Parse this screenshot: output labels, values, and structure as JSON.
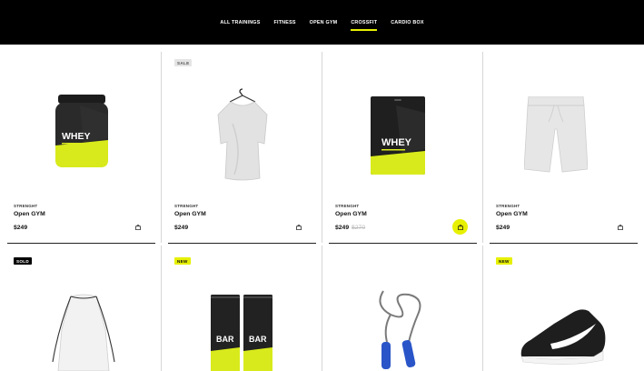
{
  "nav": {
    "tabs": [
      {
        "label": "ALL TRAININGS",
        "active": false
      },
      {
        "label": "FITNESS",
        "active": false
      },
      {
        "label": "OPEN GYM",
        "active": false
      },
      {
        "label": "CROSSFIT",
        "active": true
      },
      {
        "label": "CARDIO BOX",
        "active": false
      }
    ]
  },
  "colors": {
    "accent": "#e6f000",
    "header_bg": "#000000"
  },
  "products": [
    {
      "name": "whey-jar",
      "category": "STRENGHT",
      "title": "Open GYM",
      "price": "$249",
      "old_price": "",
      "badge": "",
      "cart_icon": "shopping-bag-icon"
    },
    {
      "name": "t-shirt",
      "category": "STRENGHT",
      "title": "Open GYM",
      "price": "$249",
      "old_price": "",
      "badge": "SALE",
      "cart_icon": "shopping-bag-icon"
    },
    {
      "name": "whey-pouch",
      "category": "STRENGHT",
      "title": "Open GYM",
      "price": "$249",
      "old_price": "$270",
      "badge": "",
      "cart_icon": "shopping-bag-icon"
    },
    {
      "name": "shorts",
      "category": "STRENGHT",
      "title": "Open GYM",
      "price": "$249",
      "old_price": "",
      "badge": "",
      "cart_icon": "shopping-bag-icon"
    },
    {
      "name": "drawstring-bag",
      "badge": "SOLD"
    },
    {
      "name": "protein-bars",
      "badge": "NEW",
      "bar_label": "BAR"
    },
    {
      "name": "jump-rope",
      "badge": ""
    },
    {
      "name": "sneaker",
      "badge": "NEW"
    }
  ],
  "labels": {
    "whey": "WHEY",
    "bar": "BAR"
  }
}
